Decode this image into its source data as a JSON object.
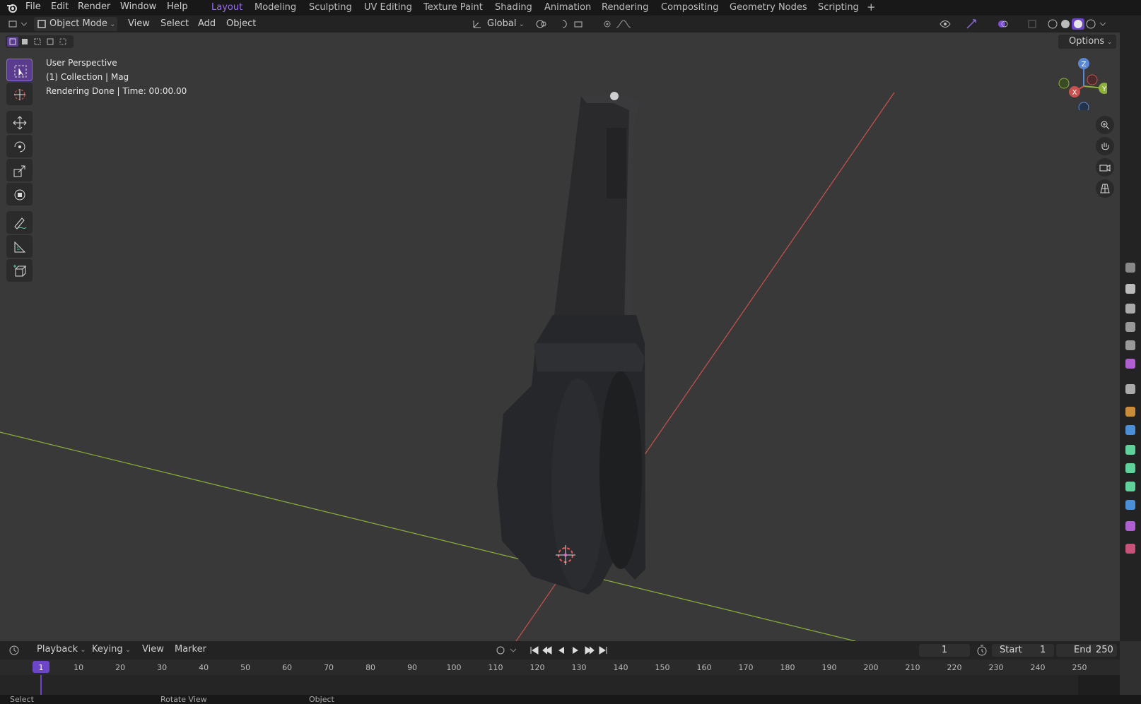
{
  "menu": {
    "file": "File",
    "edit": "Edit",
    "render": "Render",
    "window": "Window",
    "help": "Help"
  },
  "workspaces": [
    "Layout",
    "Modeling",
    "Sculpting",
    "UV Editing",
    "Texture Paint",
    "Shading",
    "Animation",
    "Rendering",
    "Compositing",
    "Geometry Nodes",
    "Scripting"
  ],
  "active_workspace": "Layout",
  "header": {
    "mode": "Object Mode",
    "view": "View",
    "select": "Select",
    "add": "Add",
    "object": "Object",
    "transform_orientation": "Global",
    "options": "Options"
  },
  "viewport": {
    "perspective": "User Perspective",
    "collection": "(1) Collection | Mag",
    "render_status": "Rendering Done | Time: 00:00.00",
    "gizmo": {
      "z": "Z",
      "x": "X",
      "y": "Y"
    }
  },
  "timeline": {
    "playback": "Playback",
    "keying": "Keying",
    "view": "View",
    "marker": "Marker",
    "current_frame": "1",
    "start_label": "Start",
    "start": "1",
    "end_label": "End",
    "end": "250",
    "ticks": [
      "1",
      "10",
      "20",
      "30",
      "40",
      "50",
      "60",
      "70",
      "80",
      "90",
      "100",
      "110",
      "120",
      "130",
      "140",
      "150",
      "160",
      "170",
      "180",
      "190",
      "200",
      "210",
      "220",
      "230",
      "240",
      "250"
    ]
  },
  "status": {
    "select": "Select",
    "rotate": "Rotate View",
    "object": "Object"
  },
  "colors": {
    "accent": "#9a6bff",
    "x_axis": "#c9524f",
    "y_axis": "#8cb03a",
    "z_axis": "#5b86d6"
  }
}
